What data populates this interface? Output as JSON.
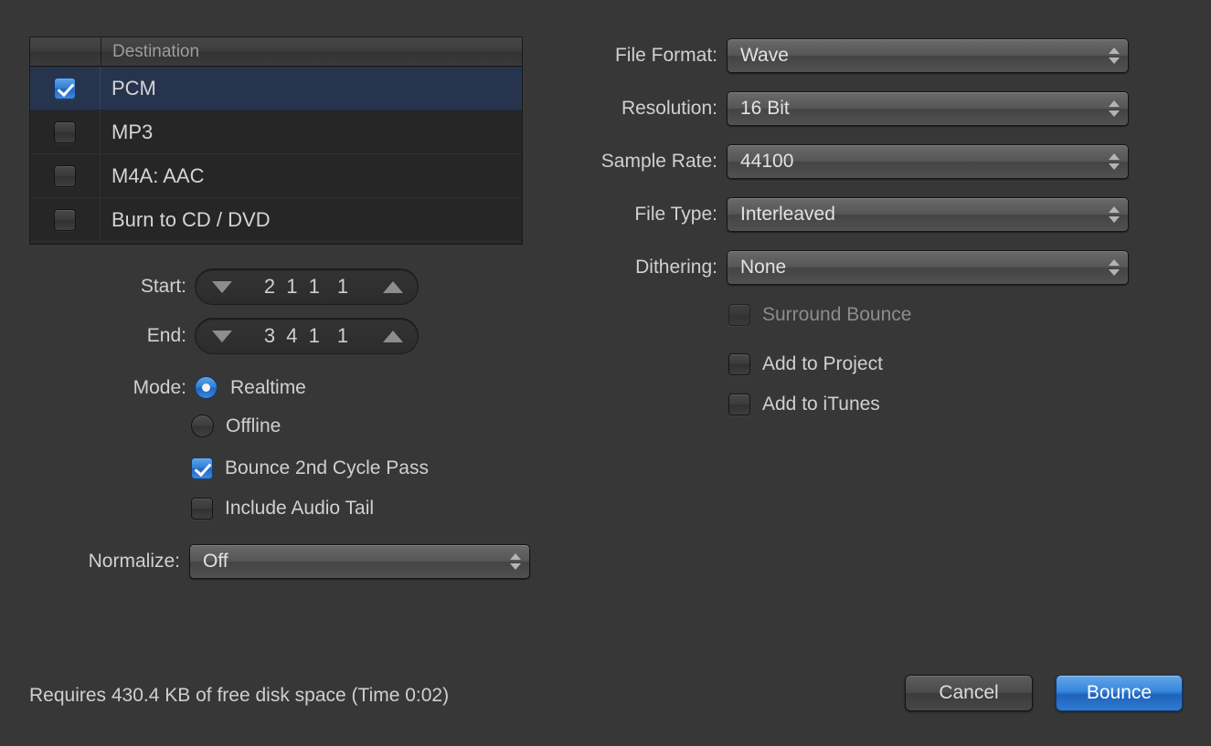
{
  "destination_table": {
    "columns": [
      "",
      "Destination"
    ],
    "header_label": "Destination",
    "rows": [
      {
        "label": "PCM",
        "checked": true,
        "selected": true
      },
      {
        "label": "MP3",
        "checked": false,
        "selected": false
      },
      {
        "label": "M4A: AAC",
        "checked": false,
        "selected": false
      },
      {
        "label": "Burn to CD / DVD",
        "checked": false,
        "selected": false
      }
    ]
  },
  "position_fields": [
    {
      "label": "Start:",
      "bars": "2 1 1",
      "ticks": "1"
    },
    {
      "label": "End:",
      "bars": "3 4 1",
      "ticks": "1"
    }
  ],
  "mode": {
    "label": "Mode:",
    "options": [
      {
        "label": "Realtime",
        "selected": true
      },
      {
        "label": "Offline",
        "selected": false
      }
    ],
    "checkboxes": [
      {
        "label": "Bounce 2nd Cycle Pass",
        "checked": true,
        "enabled": true
      },
      {
        "label": "Include Audio Tail",
        "checked": false,
        "enabled": true
      }
    ]
  },
  "normalize": {
    "label": "Normalize:",
    "value": "Off"
  },
  "audio_settings": [
    {
      "label": "File Format:",
      "value": "Wave"
    },
    {
      "label": "Resolution:",
      "value": "16 Bit"
    },
    {
      "label": "Sample Rate:",
      "value": "44100"
    },
    {
      "label": "File Type:",
      "value": "Interleaved"
    },
    {
      "label": "Dithering:",
      "value": "None"
    }
  ],
  "output_options": [
    {
      "label": "Surround Bounce",
      "checked": false,
      "enabled": false
    },
    {
      "label": "Add to Project",
      "checked": false,
      "enabled": true
    },
    {
      "label": "Add to iTunes",
      "checked": false,
      "enabled": true
    }
  ],
  "footer": {
    "status": "Requires 430.4 KB of free disk space  (Time 0:02)",
    "cancel_label": "Cancel",
    "bounce_label": "Bounce"
  },
  "colors": {
    "background": "#373737",
    "table_background": "#262626",
    "selection": "#27344d",
    "accent_blue": "#3586dc",
    "text": "#d0d0d0",
    "text_disabled": "#8c8c8c"
  }
}
